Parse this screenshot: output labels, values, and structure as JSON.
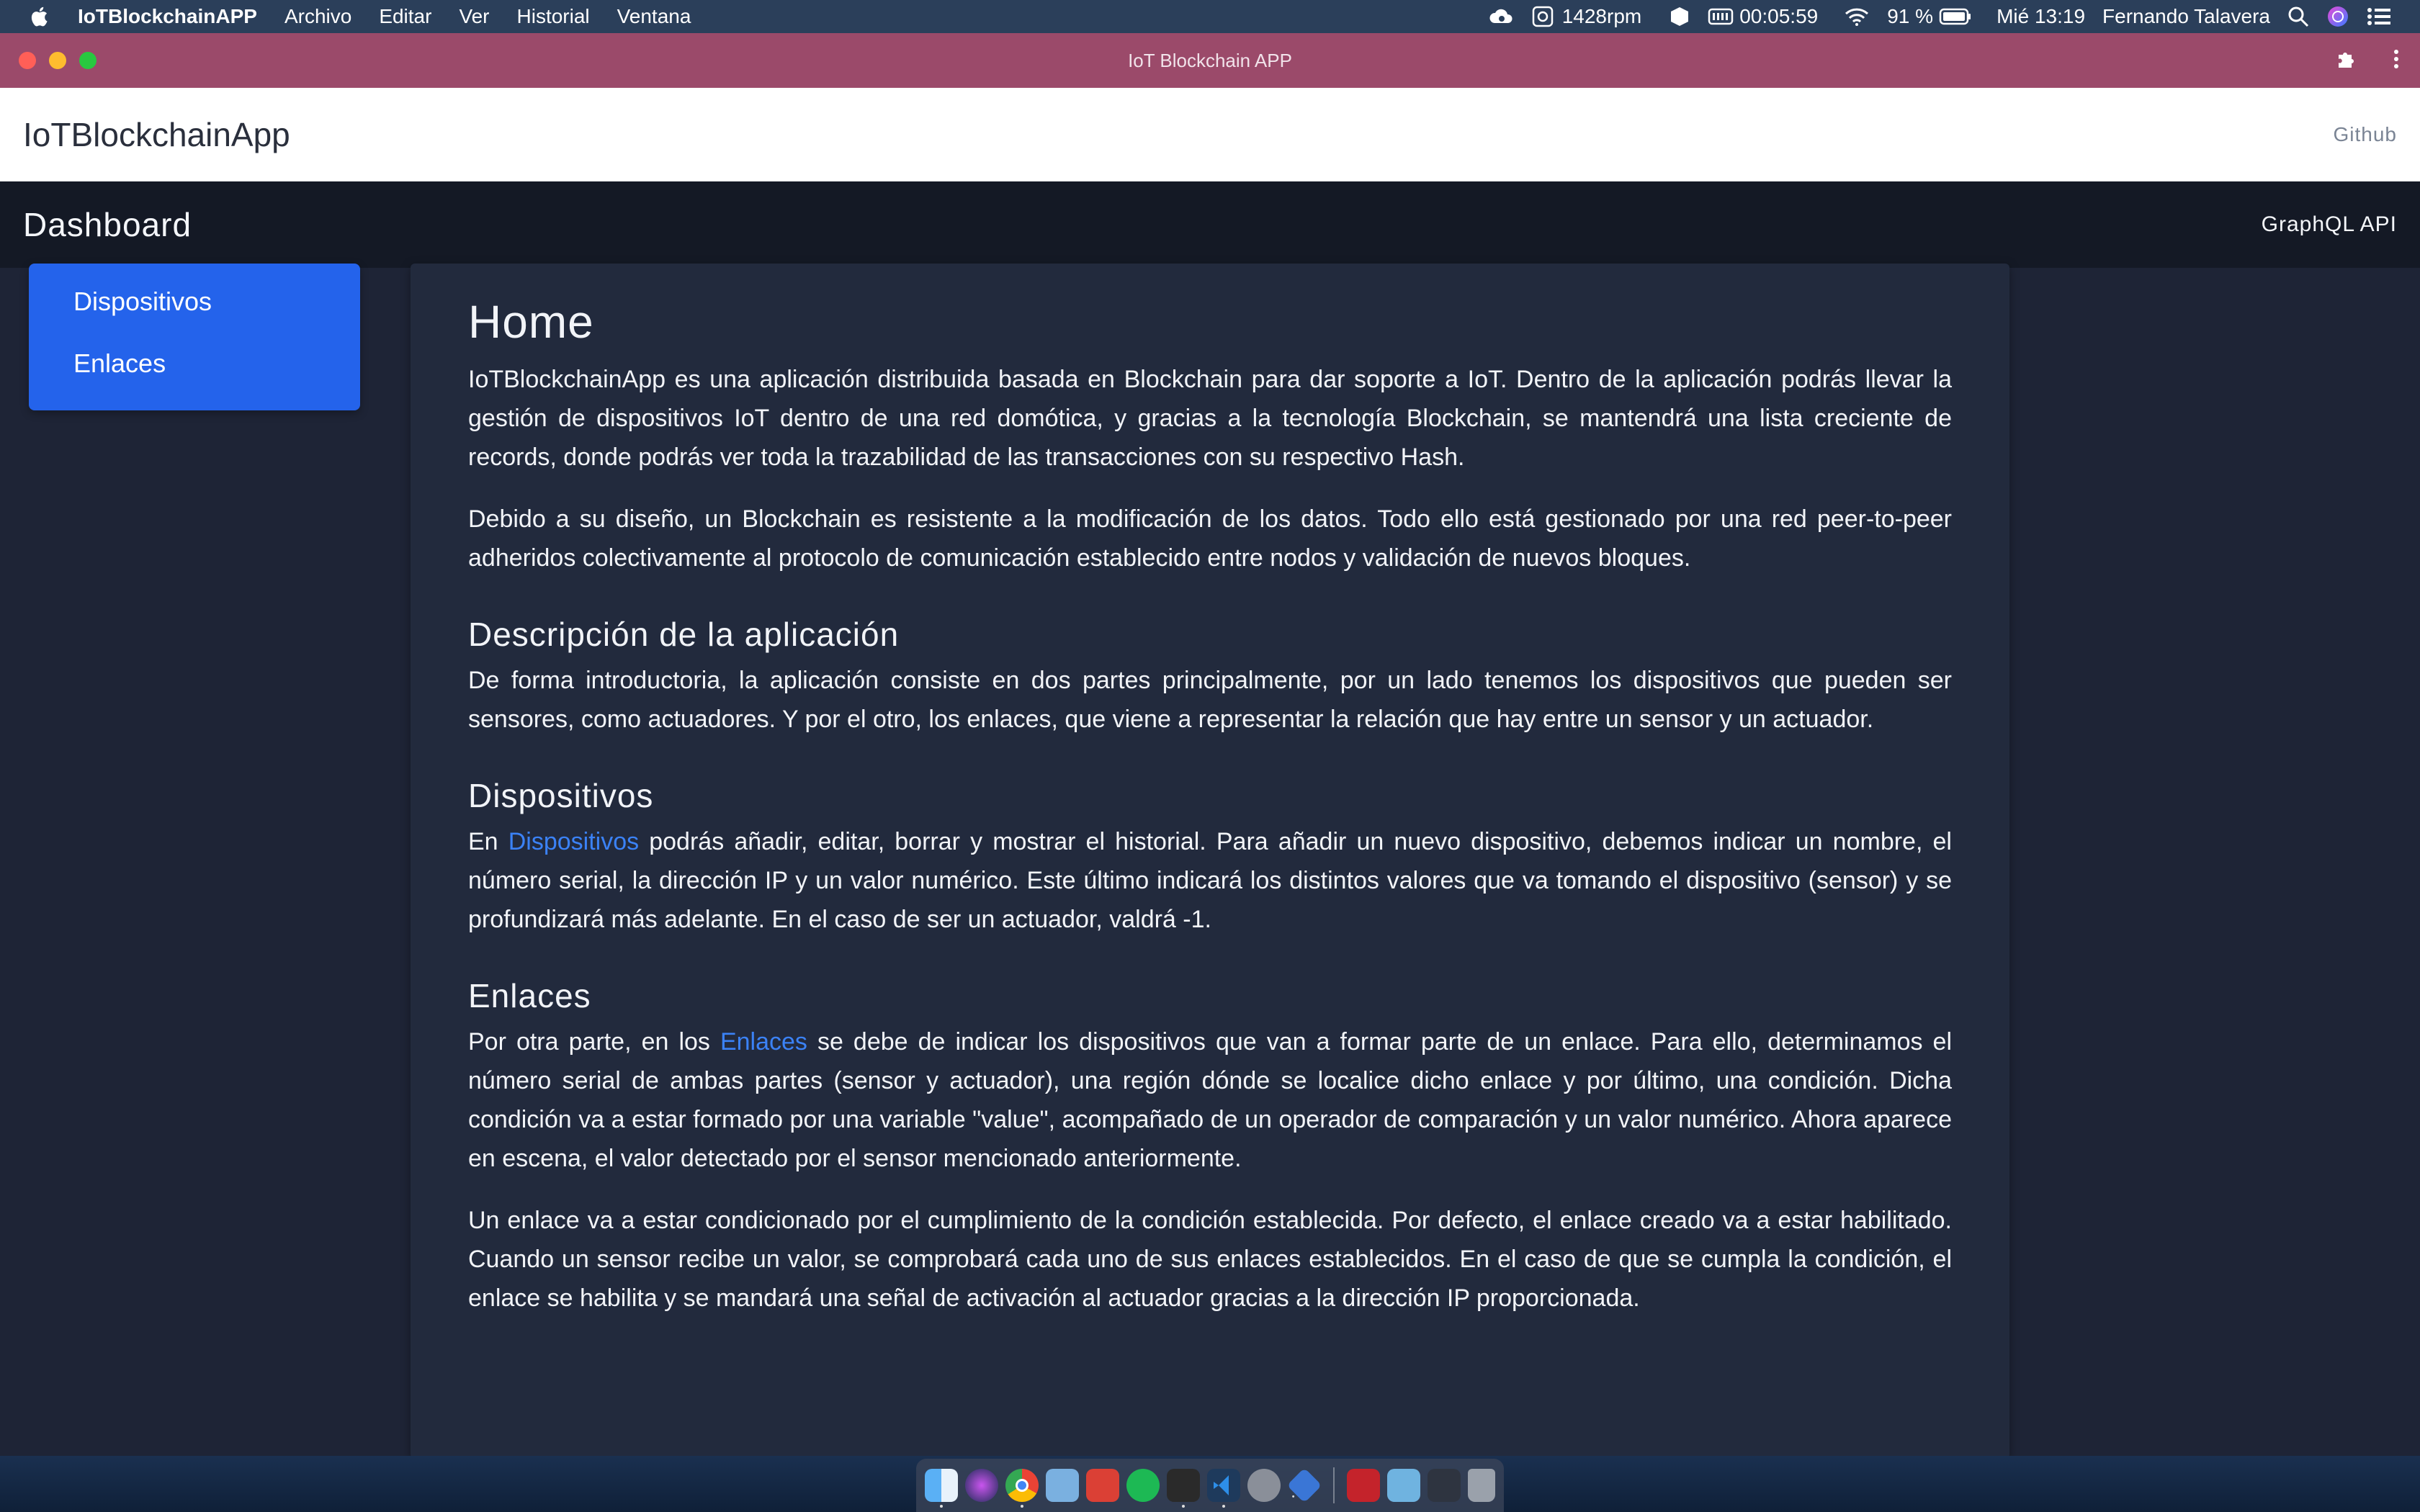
{
  "menubar": {
    "app_name": "IoTBlockchainAPP",
    "items": [
      "Archivo",
      "Editar",
      "Ver",
      "Historial",
      "Ventana"
    ],
    "fan_speed": "1428rpm",
    "timer": "00:05:59",
    "battery": "91 %",
    "datetime": "Mié 13:19",
    "user": "Fernando Talavera"
  },
  "window": {
    "title": "IoT Blockchain APP"
  },
  "topnav": {
    "brand": "IoTBlockchainApp",
    "github": "Github"
  },
  "dashbar": {
    "title": "Dashboard",
    "api": "GraphQL API"
  },
  "sidebar": {
    "items": [
      "Dispositivos",
      "Enlaces"
    ]
  },
  "content": {
    "title": "Home",
    "intro1": "IoTBlockchainApp es una aplicación distribuida basada en Blockchain para dar soporte a IoT. Dentro de la aplicación podrás llevar la gestión de dispositivos IoT dentro de una red domótica, y gracias a la tecnología Blockchain, se mantendrá una lista creciente de records, donde podrás ver toda la trazabilidad de las transacciones con su respectivo Hash.",
    "intro2": "Debido a su diseño, un Blockchain es resistente a la modificación de los datos. Todo ello está gestionado por una red peer-to-peer adheridos colectivamente al protocolo de comunicación establecido entre nodos y validación de nuevos bloques.",
    "desc_title": "Descripción de la aplicación",
    "desc_text": "De forma introductoria, la aplicación consiste en dos partes principalmente, por un lado tenemos los dispositivos que pueden ser sensores, como actuadores. Y por el otro, los enlaces, que viene a representar la relación que hay entre un sensor y un actuador.",
    "dev_title": "Dispositivos",
    "dev_pre": "En ",
    "dev_link": "Dispositivos",
    "dev_post": " podrás añadir, editar, borrar y mostrar el historial. Para añadir un nuevo dispositivo, debemos indicar un nombre, el número serial, la dirección IP y un valor numérico. Este último indicará los distintos valores que va tomando el dispositivo (sensor) y se profundizará más adelante. En el caso de ser un actuador, valdrá -1.",
    "links_title": "Enlaces",
    "links_pre": "Por otra parte, en los ",
    "links_link": "Enlaces",
    "links_post": " se debe de indicar los dispositivos que van a formar parte de un enlace. Para ello, determinamos el número serial de ambas partes (sensor y actuador), una región dónde se localice dicho enlace y por último, una condición. Dicha condición va a estar formado por una variable \"value\", acompañado de un operador de comparación y un valor numérico. Ahora aparece en escena, el valor detectado por el sensor mencionado anteriormente.",
    "links_text2": "Un enlace va a estar condicionado por el cumplimiento de la condición establecida. Por defecto, el enlace creado va a estar habilitado. Cuando un sensor recibe un valor, se comprobará cada uno de sus enlaces establecidos. En el caso de que se cumpla la condición, el enlace se habilita y se mandará una señal de activación al actuador gracias a la dirección IP proporcionada."
  },
  "dock": {
    "apps": [
      "finder-icon",
      "siri-icon",
      "chrome-icon",
      "preview-icon",
      "todoist-icon",
      "spotify-icon",
      "terminal-icon",
      "vscode-icon",
      "system-preferences-icon",
      "xcode-icon",
      "acrobat-icon",
      "folder-icon",
      "screen-icon",
      "trash-icon"
    ]
  },
  "colors": {
    "accent": "#2463eb",
    "link": "#3b82f6",
    "titlebar": "#9b4a6a",
    "background": "#1e2436",
    "panel": "#222a3d"
  }
}
